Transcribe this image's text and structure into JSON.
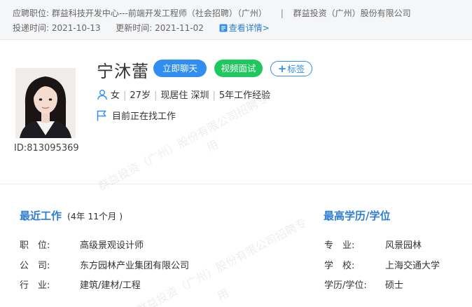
{
  "header": {
    "position_label": "应聘职位:",
    "position_value": "群益科技开发中心---前端开发工程师（社会招聘）（广州）",
    "separator": "|",
    "company": "群益投资（广州）股份有限公司",
    "applied_label": "投递时间:",
    "applied_date": "2021-10-13",
    "updated_label": "更新时间:",
    "updated_date": "2021-11-02",
    "detail_link": "查看详情>"
  },
  "candidate": {
    "name": "宁沐蕾",
    "id_text": "ID:813095369",
    "gender": "女",
    "age": "27岁",
    "residence": "现居住 深圳",
    "experience": "5年工作经验",
    "status": "目前正在找工作"
  },
  "actions": {
    "chat": "立即聊天",
    "video": "视频面试",
    "tag": "标签"
  },
  "recent_work": {
    "title": "最近工作",
    "duration": "(4年 11个月 )",
    "rows": [
      {
        "label": "职　位:",
        "value": "高级景观设计师"
      },
      {
        "label": "公　司:",
        "value": "东方园林产业集团有限公司"
      },
      {
        "label": "行　业:",
        "value": "建筑/建材/工程"
      }
    ]
  },
  "education": {
    "title": "最高学历/学位",
    "rows": [
      {
        "label": "专　业:",
        "value": "风景园林"
      },
      {
        "label": "学　校:",
        "value": "上海交通大学"
      },
      {
        "label": "学历/学位:",
        "value": "硕士"
      }
    ]
  },
  "watermark": {
    "text_a": "群益投资（广州）股份有限公司招聘专",
    "text_b": "用"
  },
  "colors": {
    "accent": "#2f8ef0",
    "video": "#1fc85f",
    "title_blue": "#2d7dd2"
  }
}
